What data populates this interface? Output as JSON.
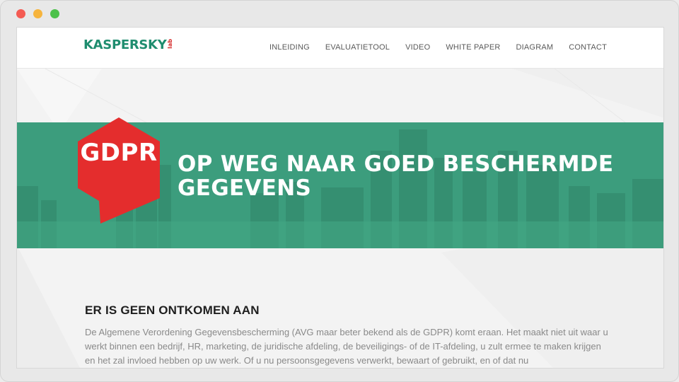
{
  "window": {
    "controls": [
      "close",
      "minimize",
      "maximize"
    ]
  },
  "header": {
    "logo": {
      "word": "KASPERSKY",
      "suffix": "lab"
    },
    "nav": [
      {
        "label": "INLEIDING"
      },
      {
        "label": "EVALUATIETOOL"
      },
      {
        "label": "VIDEO"
      },
      {
        "label": "WHITE PAPER"
      },
      {
        "label": "DIAGRAM"
      },
      {
        "label": "CONTACT"
      }
    ]
  },
  "hero": {
    "badge": "GDPR",
    "title": "OP WEG NAAR GOED BESCHERMDE GEGEVENS"
  },
  "section": {
    "heading": "ER IS GEEN ONTKOMEN AAN",
    "body": "De Algemene Verordening Gegevensbescherming (AVG maar beter bekend als de GDPR) komt eraan. Het maakt niet uit waar u werkt binnen een bedrijf, HR, marketing, de juridische afdeling, de beveiligings- of de IT-afdeling, u zult ermee te maken krijgen en het zal invloed hebben op uw werk. Of u nu persoonsgegevens verwerkt, bewaart of gebruikt, en of dat nu"
  },
  "colors": {
    "brand_green": "#1f8d6f",
    "hero_green": "#3a9b7b",
    "badge_red": "#e42d2d",
    "lab_red": "#d52b2b"
  }
}
